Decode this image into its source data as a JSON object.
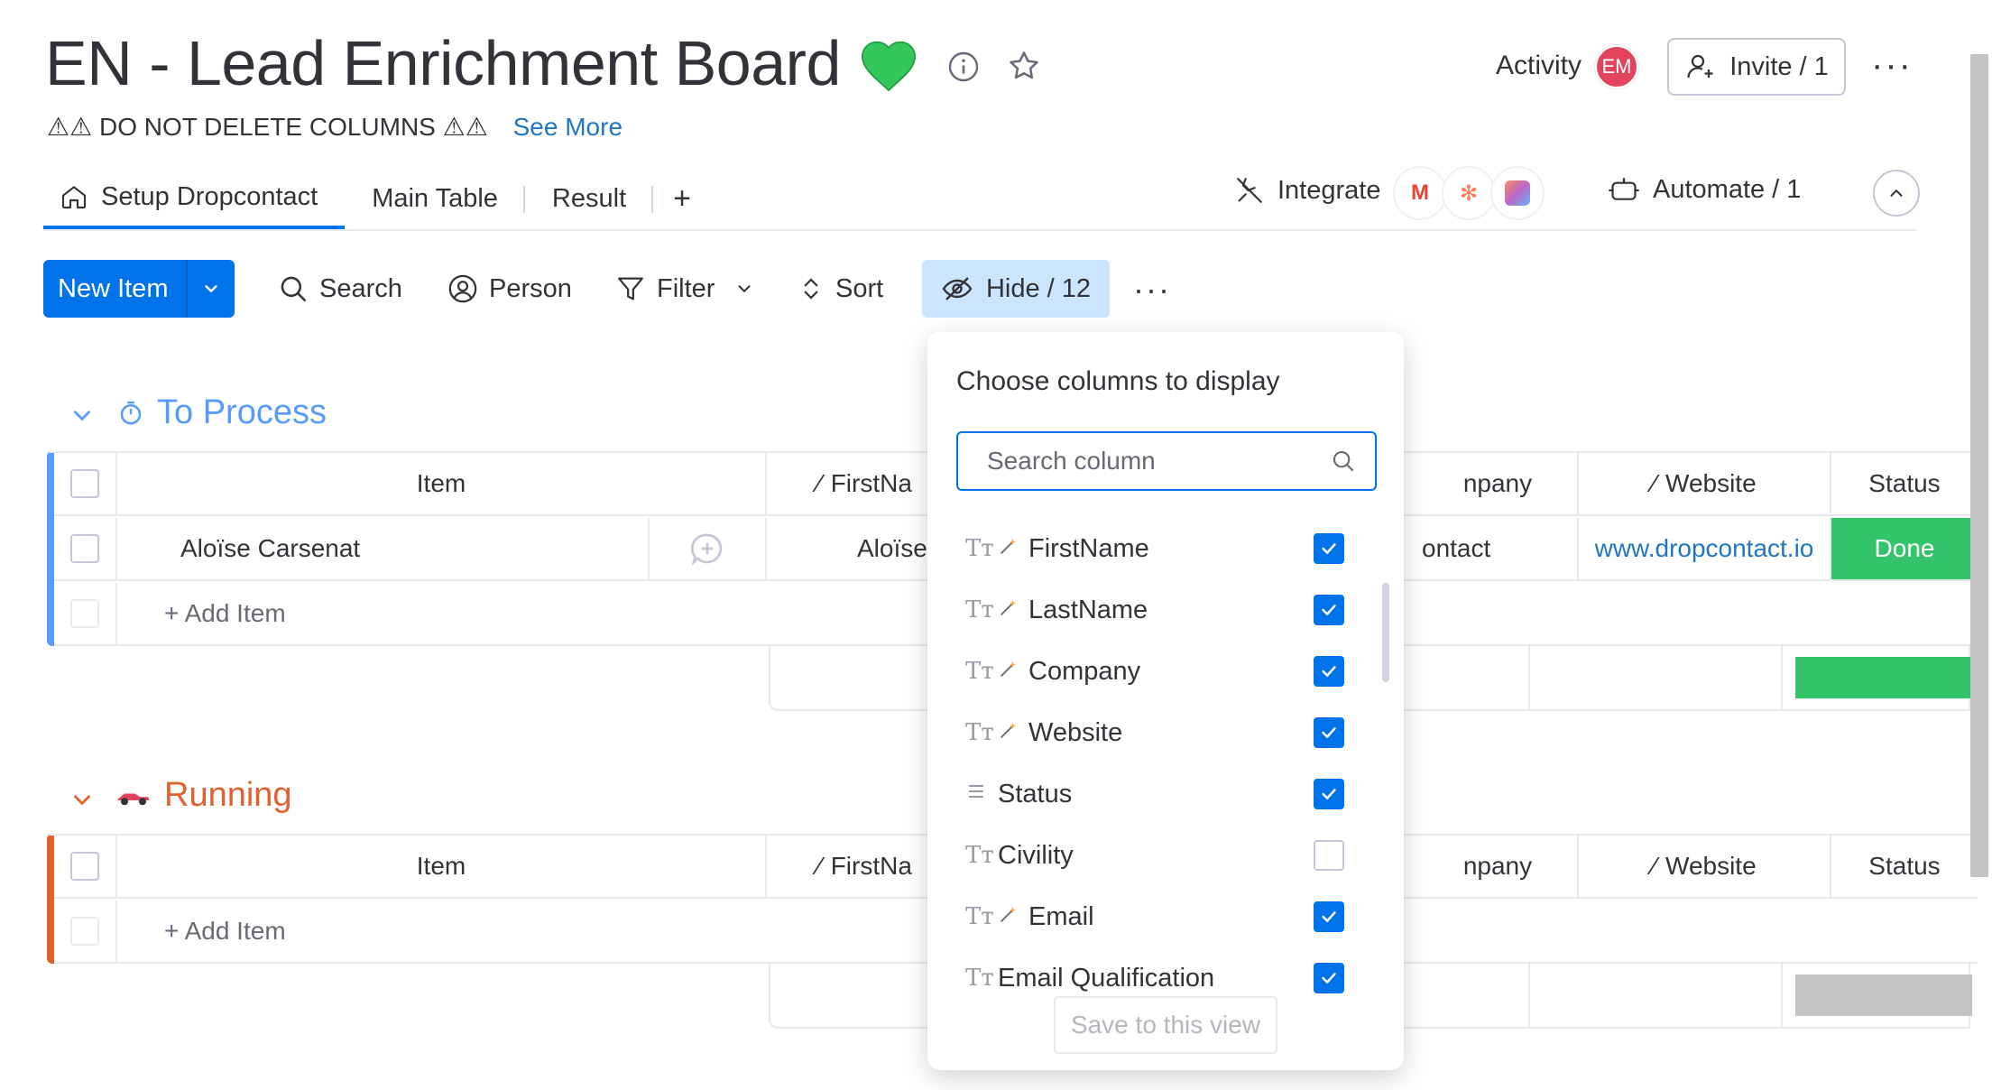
{
  "header": {
    "title": "EN - Lead Enrichment Board",
    "subtitle": "⚠⚠ DO NOT DELETE COLUMNS ⚠⚠",
    "see_more": "See More",
    "activity": "Activity",
    "avatar_initials": "EM",
    "invite": "Invite / 1"
  },
  "tabs": [
    {
      "label": "Setup Dropcontact",
      "active": true
    },
    {
      "label": "Main Table"
    },
    {
      "label": "Result"
    }
  ],
  "tab_add": "+",
  "integrate": "Integrate",
  "automate": "Automate / 1",
  "toolbar": {
    "new_item": "New Item",
    "search": "Search",
    "person": "Person",
    "filter": "Filter",
    "sort": "Sort",
    "hide": "Hide / 12"
  },
  "groups": [
    {
      "name": "To Process",
      "color": "#579bfc",
      "header": {
        "item": "Item",
        "firstname": "FirstNa",
        "company": "npany",
        "website": "Website",
        "status": "Status"
      },
      "rows": [
        {
          "item": "Aloïse Carsenat",
          "firstname": "Aloïse",
          "company": "ontact",
          "website": "www.dropcontact.io",
          "status": "Done"
        }
      ],
      "add_item": "+ Add Item"
    },
    {
      "name": "Running",
      "color": "#e2612d",
      "header": {
        "item": "Item",
        "firstname": "FirstNa",
        "company": "npany",
        "website": "Website",
        "status": "Status"
      },
      "rows": [],
      "add_item": "+ Add Item"
    }
  ],
  "column_picker": {
    "title": "Choose columns to display",
    "search_placeholder": "Search column",
    "columns": [
      {
        "type": "text",
        "wand": true,
        "label": "FirstName",
        "checked": true
      },
      {
        "type": "text",
        "wand": true,
        "label": "LastName",
        "checked": true
      },
      {
        "type": "text",
        "wand": true,
        "label": "Company",
        "checked": true
      },
      {
        "type": "text",
        "wand": true,
        "label": "Website",
        "checked": true
      },
      {
        "type": "status",
        "wand": false,
        "label": "Status",
        "checked": true
      },
      {
        "type": "text",
        "wand": false,
        "label": "Civility",
        "checked": false
      },
      {
        "type": "text",
        "wand": true,
        "label": "Email",
        "checked": true
      },
      {
        "type": "text",
        "wand": false,
        "label": "Email Qualification",
        "checked": true
      }
    ],
    "save_button": "Save to this view"
  }
}
